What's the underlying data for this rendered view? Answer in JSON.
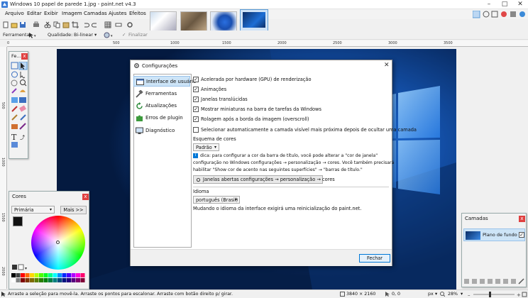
{
  "window": {
    "title": "Windows 10 papel de parede 1.jpg - paint.net v4.3",
    "controls": [
      "–",
      "□",
      "✕"
    ]
  },
  "menu": [
    "Arquivo",
    "Editar",
    "Exibir",
    "Imagem",
    "Camadas",
    "Ajustes",
    "Efeitos"
  ],
  "toolbar2": {
    "tool_label": "Ferramenta:",
    "quality_label": "Qualidade:",
    "quality_value": "Bi-linear",
    "finalize_label": "Finalizar"
  },
  "ruler_h": [
    "0",
    "500",
    "1000",
    "1500",
    "2000",
    "2500",
    "3000",
    "3500"
  ],
  "ruler_v": [
    "500",
    "1000",
    "1500",
    "2000"
  ],
  "tools_panel": {
    "title": "Fe..."
  },
  "colors_panel": {
    "title": "Cores",
    "primary_select": "Primária",
    "more_button": "Mais >>"
  },
  "layers_panel": {
    "title": "Camadas",
    "layer_name": "Plano de fundo"
  },
  "dialog": {
    "title": "Configurações",
    "nav": [
      "Interface de usuário",
      "Ferramentas",
      "Atualizações",
      "Erros de plugin",
      "Diagnóstico"
    ],
    "options": [
      {
        "label": "Acelerada por hardware (GPU) de renderização",
        "checked": true
      },
      {
        "label": "Animações",
        "checked": true
      },
      {
        "label": "Janelas translúcidas",
        "checked": true
      },
      {
        "label": "Mostrar miniaturas na barra de tarefas da Windows",
        "checked": true
      },
      {
        "label": "Rolagem após a borda da imagem (overscroll)",
        "checked": true
      },
      {
        "label": "Selecionar automaticamente a camada visível mais próxima depois de ocultar uma camada",
        "checked": false
      }
    ],
    "scheme_label": "Esquema de cores",
    "scheme_value": "Padrão",
    "tip_lines": [
      "dica: para configurar a cor da barra de título, você pode alterar a \"cor de janela\"",
      "configuração no Windows configurações → personalização → cores. Você também precisará",
      "habilitar \"Show cor de acento nas seguintes superfícies\" → \"barras de título.\""
    ],
    "open_settings_button": "Janelas abertas configurações → personalização → cores",
    "language_label": "Idioma",
    "language_value": "português (Brasil)",
    "language_note": "Mudando o idioma da interface exigirá uma reinicialização do paint.net.",
    "close_button": "Fechar"
  },
  "status": {
    "hint": "Arraste a seleção para movê-la. Arraste os pontos para escalonar. Arraste com botão direito p/ girar.",
    "size": "3840 × 2160",
    "coords": "0, 0",
    "unit": "px",
    "zoom": "28%"
  },
  "colors": {
    "accent": "#0078d7",
    "canvas": "#0a2f6b",
    "close": "#e04040"
  }
}
